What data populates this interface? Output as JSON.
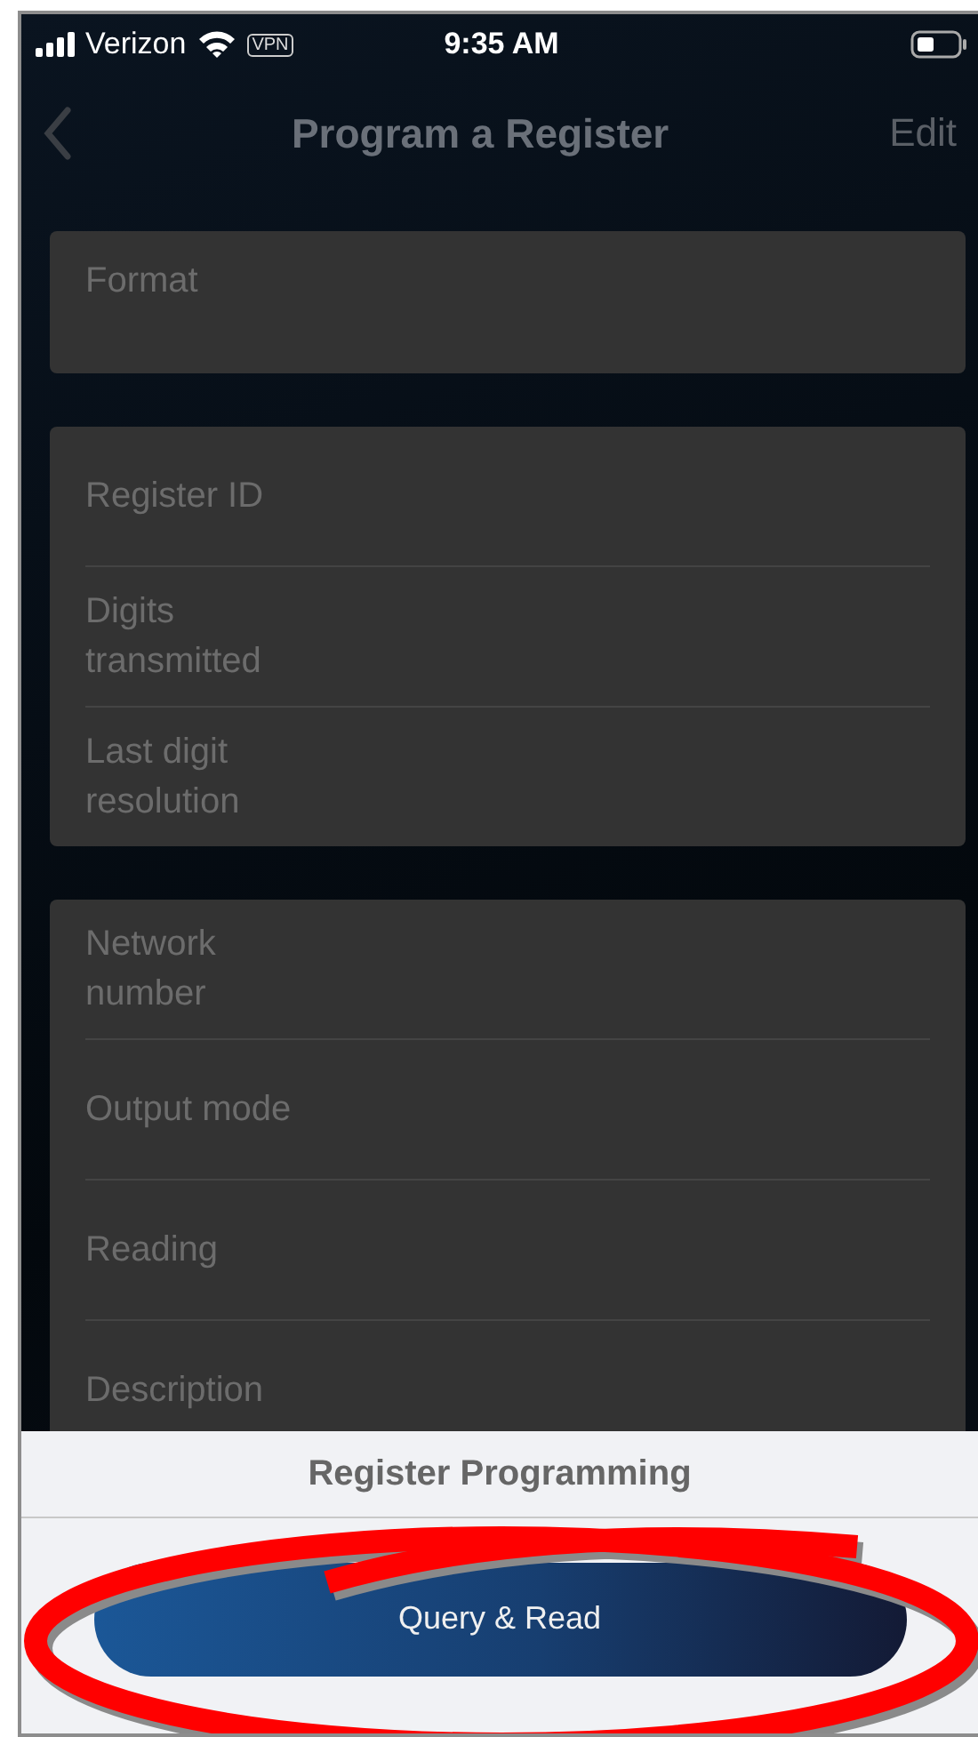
{
  "status_bar": {
    "carrier": "Verizon",
    "vpn": "VPN",
    "time": "9:35 AM"
  },
  "nav": {
    "title": "Program a Register",
    "action": "Edit"
  },
  "sections": [
    {
      "fields": [
        {
          "label": "Format"
        }
      ]
    },
    {
      "fields": [
        {
          "label": "Register ID"
        },
        {
          "label": "Digits transmitted"
        },
        {
          "label": "Last digit resolution"
        }
      ]
    },
    {
      "fields": [
        {
          "label": "Network number"
        },
        {
          "label": "Output mode"
        },
        {
          "label": "Reading"
        },
        {
          "label": "Description"
        }
      ]
    }
  ],
  "sheet": {
    "title": "Register Programming",
    "button": "Query & Read"
  }
}
